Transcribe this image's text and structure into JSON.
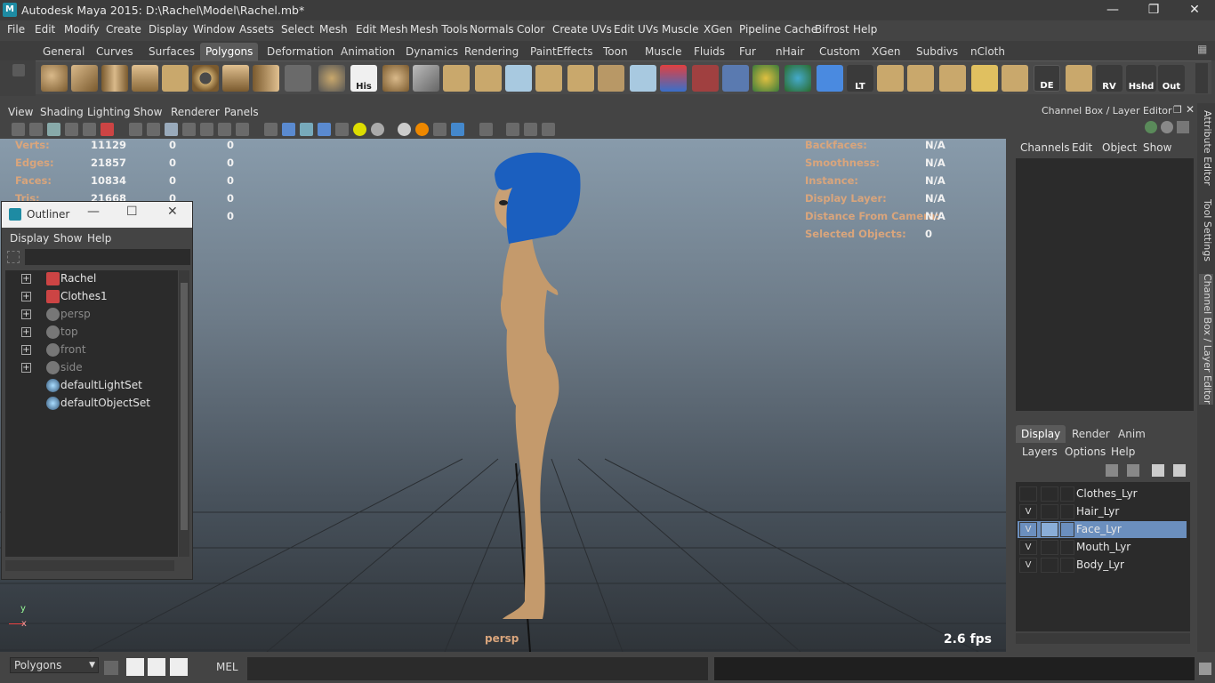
{
  "window": {
    "title": "Autodesk Maya 2015: D:\\Rachel\\Model\\Rachel.mb*",
    "logo_text": "M"
  },
  "menubar": [
    "File",
    "Edit",
    "Modify",
    "Create",
    "Display",
    "Window",
    "Assets",
    "Select",
    "Mesh",
    "Edit Mesh",
    "Mesh Tools",
    "Normals",
    "Color",
    "Create UVs",
    "Edit UVs",
    "Muscle",
    "XGen",
    "Pipeline Cache",
    "Bifrost",
    "Help"
  ],
  "shelf": {
    "tabs": [
      "General",
      "Curves",
      "Surfaces",
      "Polygons",
      "Deformation",
      "Animation",
      "Dynamics",
      "Rendering",
      "PaintEffects",
      "Toon",
      "Muscle",
      "Fluids",
      "Fur",
      "nHair",
      "Custom",
      "XGen",
      "Subdivs",
      "nCloth"
    ],
    "active_tab": "Polygons",
    "icon_labels": {
      "his": "His",
      "lt": "LT",
      "de": "DE",
      "rv": "RV",
      "hshd": "Hshd",
      "out": "Out"
    }
  },
  "viewport": {
    "menus": [
      "View",
      "Shading",
      "Lighting",
      "Show",
      "Renderer",
      "Panels"
    ],
    "hud_left": [
      {
        "label": "Verts:",
        "v1": "11129",
        "v2": "0",
        "v3": "0"
      },
      {
        "label": "Edges:",
        "v1": "21857",
        "v2": "0",
        "v3": "0"
      },
      {
        "label": "Faces:",
        "v1": "10834",
        "v2": "0",
        "v3": "0"
      },
      {
        "label": "Tris:",
        "v1": "21668",
        "v2": "0",
        "v3": "0"
      },
      {
        "label": "",
        "v1": "",
        "v2": "0",
        "v3": "0"
      }
    ],
    "hud_right": [
      {
        "label": "Backfaces:",
        "value": "N/A"
      },
      {
        "label": "Smoothness:",
        "value": "N/A"
      },
      {
        "label": "Instance:",
        "value": "N/A"
      },
      {
        "label": "Display Layer:",
        "value": "N/A"
      },
      {
        "label": "Distance From Camera:",
        "value": "N/A"
      },
      {
        "label": "Selected Objects:",
        "value": "0"
      }
    ],
    "camera": "persp",
    "fps": "2.6 fps",
    "axis_y": "y",
    "axis_x": "x"
  },
  "outliner": {
    "title": "Outliner",
    "menus": [
      "Display",
      "Show",
      "Help"
    ],
    "items": [
      {
        "label": "Rachel",
        "expandable": true,
        "dim": false,
        "icon": "mesh-icon"
      },
      {
        "label": "Clothes1",
        "expandable": true,
        "dim": false,
        "icon": "mesh-icon"
      },
      {
        "label": "persp",
        "expandable": true,
        "dim": true,
        "icon": "camera-icon"
      },
      {
        "label": "top",
        "expandable": true,
        "dim": true,
        "icon": "camera-icon"
      },
      {
        "label": "front",
        "expandable": true,
        "dim": true,
        "icon": "camera-icon"
      },
      {
        "label": "side",
        "expandable": true,
        "dim": true,
        "icon": "camera-icon"
      },
      {
        "label": "defaultLightSet",
        "expandable": false,
        "dim": false,
        "icon": "set-icon"
      },
      {
        "label": "defaultObjectSet",
        "expandable": false,
        "dim": false,
        "icon": "set-icon"
      }
    ]
  },
  "channel_box": {
    "title": "Channel Box / Layer Editor",
    "menus": [
      "Channels",
      "Edit",
      "Object",
      "Show"
    ],
    "layer_tabs": [
      "Display",
      "Render",
      "Anim"
    ],
    "active_layer_tab": "Display",
    "layer_menus": [
      "Layers",
      "Options",
      "Help"
    ],
    "layers": [
      {
        "name": "Clothes_Lyr",
        "visible": "",
        "selected": false
      },
      {
        "name": "Hair_Lyr",
        "visible": "V",
        "selected": false
      },
      {
        "name": "Face_Lyr",
        "visible": "V",
        "selected": true
      },
      {
        "name": "Mouth_Lyr",
        "visible": "V",
        "selected": false
      },
      {
        "name": "Body_Lyr",
        "visible": "V",
        "selected": false
      }
    ]
  },
  "side_tabs": [
    "Attribute Editor",
    "Tool Settings",
    "Channel Box / Layer Editor"
  ],
  "bottom": {
    "mode": "Polygons",
    "mel_label": "MEL"
  },
  "colors": {
    "accent_selected": "#6b8fbe",
    "hud_label": "#d9a57c",
    "hair": "#1b5fbf",
    "skin": "#c49a6c"
  }
}
